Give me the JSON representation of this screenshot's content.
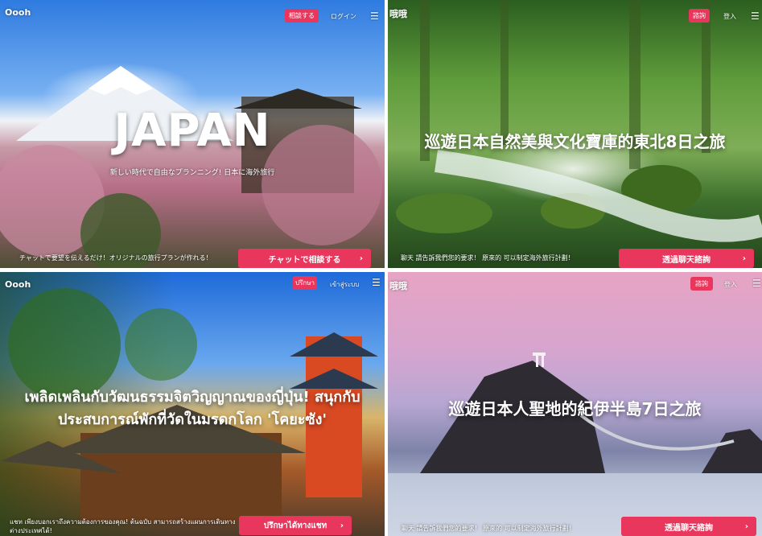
{
  "panels": [
    {
      "logo": "Oooh",
      "consult": "相談する",
      "login": "ログイン",
      "hero": "JAPAN",
      "sub": "新しい時代で自由なプランニング! 日本に海外旅行",
      "bottom": "チャットで要望を伝えるだけ！オリジナルの旅行プランが作れる！",
      "cta": "チャットで相談する"
    },
    {
      "logo": "哦哦",
      "consult": "諮詢",
      "login": "登入",
      "hero": "巡遊日本自然美與文化寶庫的東北8日之旅",
      "bottom": "聊天 請告訴我們您的要求！ 原來的 可以制定海外旅行計劃！",
      "cta": "透過聊天諮詢"
    },
    {
      "logo": "Oooh",
      "consult": "ปรึกษา",
      "login": "เข้าสู่ระบบ",
      "hero_line1": "เพลิดเพลินกับวัฒนธรรมจิตวิญญาณของญี่ปุ่น! สนุกกับ",
      "hero_line2": "ประสบการณ์พักที่วัดในมรดกโลก 'โคยะซัง'",
      "bottom_line1": "แชท เพียงบอกเราถึงความต้องการของคุณ! ต้นฉบับ สามารถสร้างแผนการเดินทาง",
      "bottom_line2": "ต่างประเทศได้!",
      "cta": "ปรึกษาได้ทางแชท"
    },
    {
      "logo": "哦哦",
      "consult": "諮詢",
      "login": "登入",
      "hero": "巡遊日本人聖地的紀伊半島7日之旅",
      "bottom": "聊天 請告訴我們您的要求！ 原來的 可以制定海外旅行計劃！",
      "cta": "透過聊天諮詢"
    }
  ],
  "icons": {
    "menu": "menu-icon",
    "chevron": "chevron-right-icon"
  },
  "colors": {
    "accent": "#e8365c"
  }
}
